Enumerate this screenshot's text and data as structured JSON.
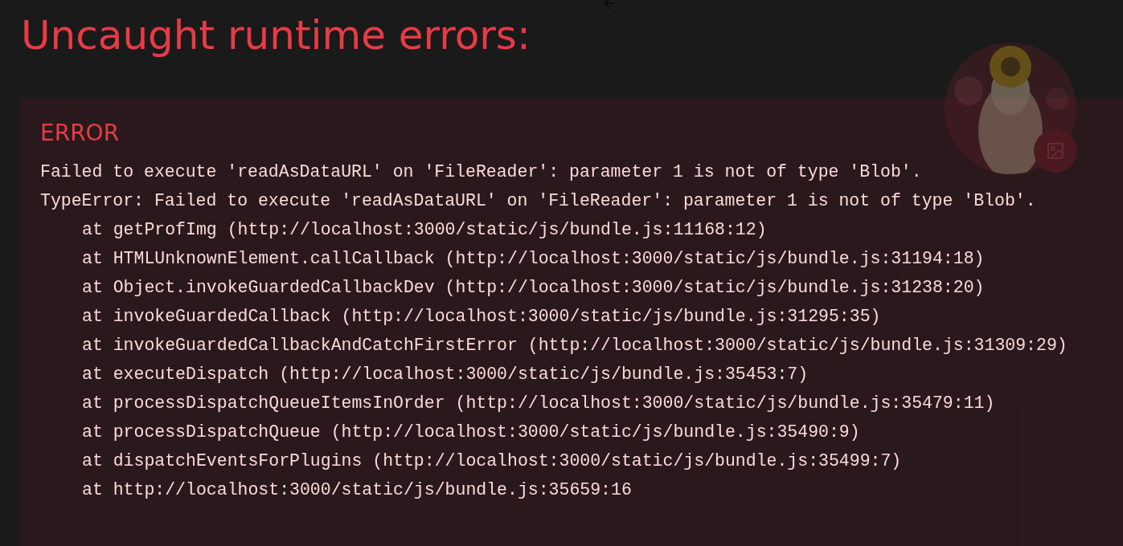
{
  "overlay": {
    "title": "Uncaught runtime errors:"
  },
  "error": {
    "label": "ERROR",
    "message": "Failed to execute 'readAsDataURL' on 'FileReader': parameter 1 is not of type 'Blob'.",
    "type_line": "TypeError: Failed to execute 'readAsDataURL' on 'FileReader': parameter 1 is not of type 'Blob'.",
    "stack": [
      "at getProfImg (http://localhost:3000/static/js/bundle.js:11168:12)",
      "at HTMLUnknownElement.callCallback (http://localhost:3000/static/js/bundle.js:31194:18)",
      "at Object.invokeGuardedCallbackDev (http://localhost:3000/static/js/bundle.js:31238:20)",
      "at invokeGuardedCallback (http://localhost:3000/static/js/bundle.js:31295:35)",
      "at invokeGuardedCallbackAndCatchFirstError (http://localhost:3000/static/js/bundle.js:31309:29)",
      "at executeDispatch (http://localhost:3000/static/js/bundle.js:35453:7)",
      "at processDispatchQueueItemsInOrder (http://localhost:3000/static/js/bundle.js:35479:11)",
      "at processDispatchQueue (http://localhost:3000/static/js/bundle.js:35490:9)",
      "at dispatchEventsForPlugins (http://localhost:3000/static/js/bundle.js:35499:7)",
      "at http://localhost:3000/static/js/bundle.js:35659:16"
    ]
  }
}
